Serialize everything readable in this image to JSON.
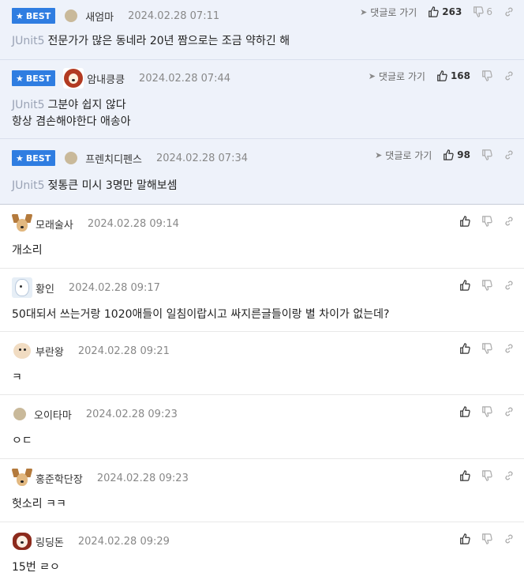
{
  "common": {
    "best_label": "BEST",
    "reply_label": "댓글로 가기"
  },
  "best_comments": [
    {
      "nick": "새엄마",
      "date": "2024.02.28 07:11",
      "likes": "263",
      "dislikes": "6",
      "tag": "JUnit5",
      "lines": [
        "전문가가 많은 동네라 20년 짬으로는 조금 약하긴 해"
      ],
      "avatar": "dot"
    },
    {
      "nick": "암내킁킁",
      "date": "2024.02.28 07:44",
      "likes": "168",
      "dislikes": "",
      "tag": "JUnit5",
      "lines": [
        "그분야 쉽지 않다",
        "항상 겸손해야한다 애송아"
      ],
      "avatar": "lion-icon"
    },
    {
      "nick": "프렌치디펜스",
      "date": "2024.02.28 07:34",
      "likes": "98",
      "dislikes": "",
      "tag": "JUnit5",
      "lines": [
        "젖통큰 미시 3명만 말해보셈"
      ],
      "avatar": "dot"
    }
  ],
  "comments": [
    {
      "nick": "모래술사",
      "date": "2024.02.28 09:14",
      "text": "개소리",
      "avatar": "dog-icon"
    },
    {
      "nick": "황인",
      "date": "2024.02.28 09:17",
      "text": "50대되서 쓰는거랑 1020애들이 일침이랍시고 싸지른글들이랑 별 차이가 없는데?",
      "avatar": "white-dog-icon"
    },
    {
      "nick": "부란왕",
      "date": "2024.02.28 09:21",
      "text": "ㅋ",
      "avatar": "pom-icon"
    },
    {
      "nick": "오이타마",
      "date": "2024.02.28 09:23",
      "text": "ㅇㄷ",
      "avatar": "dot"
    },
    {
      "nick": "홍준학단장",
      "date": "2024.02.28 09:23",
      "text": "헛소리 ㅋㅋ",
      "avatar": "dog-icon"
    },
    {
      "nick": "링딩돈",
      "date": "2024.02.28 09:29",
      "text": "15번 ㄹㅇ",
      "avatar": "ding-icon"
    }
  ],
  "colors": {
    "best_bg": "#eef2fa",
    "badge": "#2f7de1",
    "tag": "#9aa3b5"
  }
}
